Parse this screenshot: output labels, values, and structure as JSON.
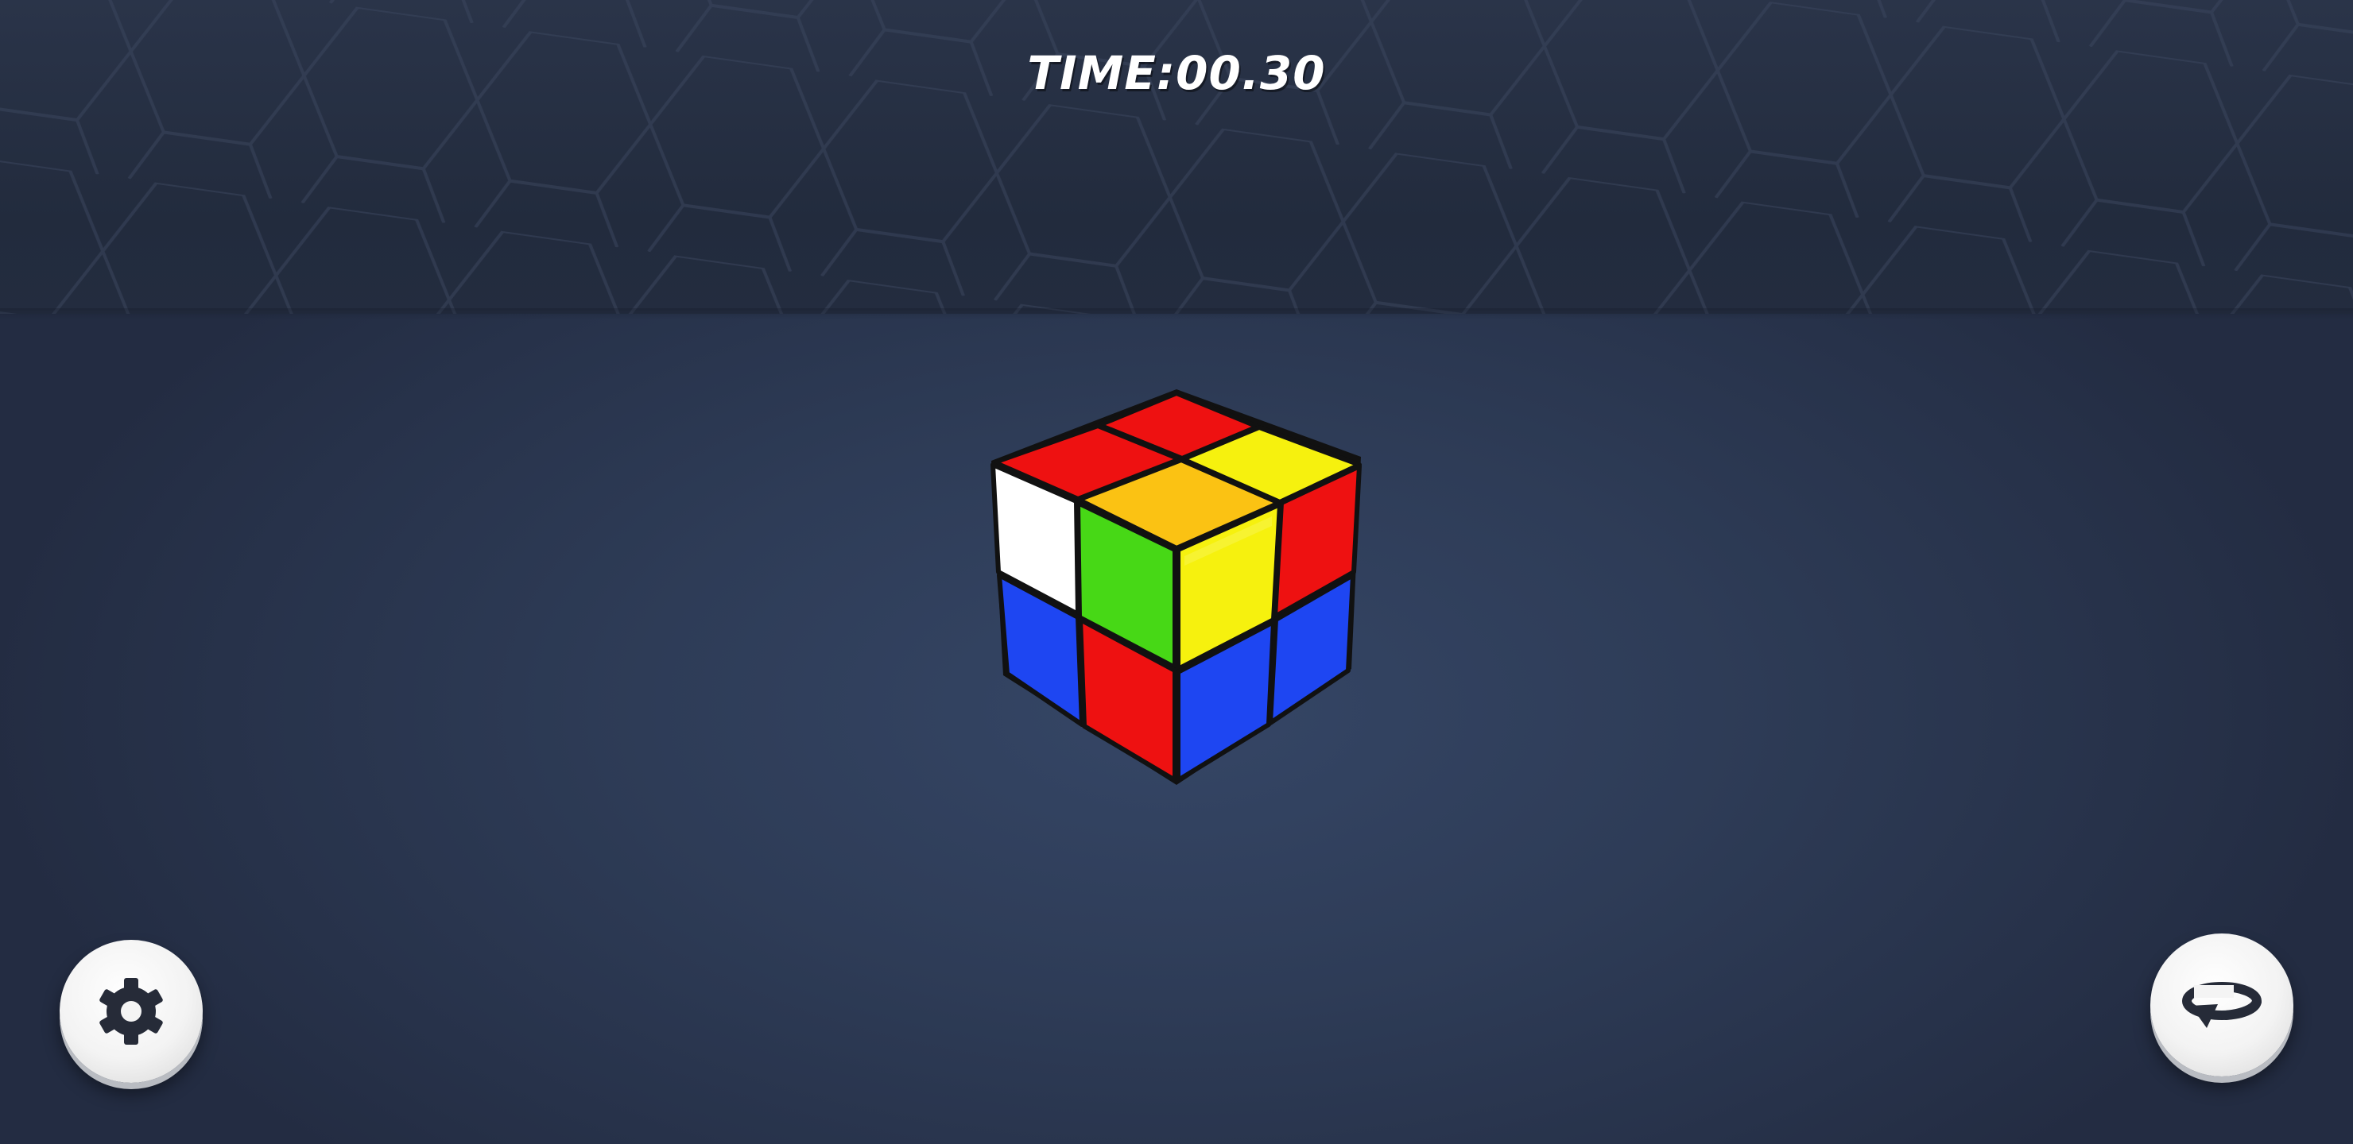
{
  "hud": {
    "time_label": "TIME:",
    "time_value": "00.30"
  },
  "cube": {
    "size": "2x2",
    "top_face": [
      "red",
      "red",
      "yellow",
      "orange"
    ],
    "left_face": [
      "white",
      "green",
      "blue",
      "red"
    ],
    "right_face": [
      "yellow",
      "red",
      "blue",
      "blue"
    ]
  },
  "buttons": {
    "settings_icon": "gear-icon",
    "rotate_icon": "rotate-view-icon"
  },
  "colors": {
    "red": "#ee1111",
    "yellow": "#f6f10e",
    "orange": "#fbc213",
    "white": "#ffffff",
    "green": "#47d816",
    "blue": "#1e46f2",
    "background": "#2e3c57",
    "icon": "#262b38"
  }
}
